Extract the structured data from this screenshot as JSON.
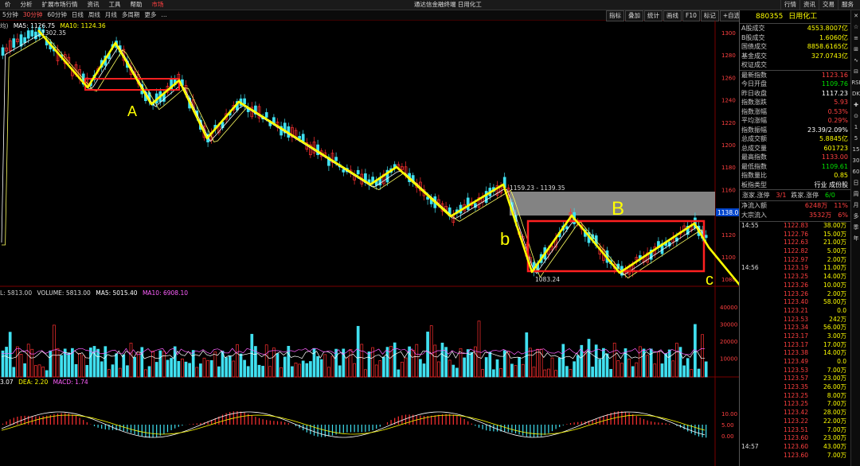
{
  "menu": {
    "items": [
      "价",
      "分析",
      "扩展市场行情",
      "资讯",
      "工具",
      "帮助",
      "市场"
    ],
    "title": "通达信金融终端  日用化工",
    "right": [
      "行情",
      "资讯",
      "交易",
      "服务"
    ]
  },
  "toolbar": {
    "tabs": [
      "5分钟",
      "30分钟",
      "60分钟",
      "日线",
      "周线",
      "月线",
      "多周期",
      "更多",
      "…"
    ],
    "active_index": 1,
    "right_tools": [
      "指标",
      "叠加",
      "统计",
      "画线",
      "F10",
      "标记",
      "+自选",
      "返回"
    ]
  },
  "ma_line": {
    "prefix": "均)",
    "ma5": "MA5: 1126.75",
    "ma10": "MA10: 1124.36"
  },
  "vol_line": {
    "prefix": "L: 5813.00",
    "volume": "VOLUME: 5813.00",
    "ma5": "MA5: 5015.40",
    "ma10": "MA10: 6908.10"
  },
  "macd_line": {
    "dif": "3.07",
    "dea": "DEA: 2.20",
    "macd": "MACD: 1.74"
  },
  "price_axis": [
    "1300",
    "1280",
    "1260",
    "1240",
    "1220",
    "1200",
    "1180",
    "1160",
    "1140",
    "1120",
    "1100",
    "1080"
  ],
  "vol_axis": [
    "40000",
    "30000",
    "20000",
    "10000"
  ],
  "macd_axis": [
    "10.00",
    "5.00",
    "0.00"
  ],
  "annotations": {
    "high_label": "1302.35",
    "mid_label": "1159.23 - 1139.35",
    "low_label": "1083.24",
    "price_tag": "1138.0",
    "letter_a": "A",
    "letter_b": "B",
    "letter_b_small": "b",
    "letter_c": "c"
  },
  "panel": {
    "code": "880355",
    "name": "日用化工",
    "stats": [
      {
        "k": "A股成交",
        "v": "4553.8007亿",
        "c": "#ffff00"
      },
      {
        "k": "B股成交",
        "v": "1.6060亿",
        "c": "#ffff00"
      },
      {
        "k": "国债成交",
        "v": "8858.6165亿",
        "c": "#ffff00"
      },
      {
        "k": "基金成交",
        "v": "327.0743亿",
        "c": "#ffff00"
      },
      {
        "k": "权证成交",
        "v": "",
        "c": "#ffff00"
      }
    ],
    "quote": [
      {
        "k": "最新指数",
        "v": "1123.16",
        "c": "#ff4040"
      },
      {
        "k": "今日开盘",
        "v": "1109.76",
        "c": "#00e000"
      },
      {
        "k": "昨日收盘",
        "v": "1117.23",
        "c": "#ffffff"
      },
      {
        "k": "指数涨跌",
        "v": "5.93",
        "c": "#ff4040"
      },
      {
        "k": "指数涨幅",
        "v": "0.53%",
        "c": "#ff4040"
      },
      {
        "k": "平均涨幅",
        "v": "0.29%",
        "c": "#ff4040"
      },
      {
        "k": "指数振幅",
        "v": "23.39/2.09%",
        "c": "#ffffff"
      },
      {
        "k": "总成交额",
        "v": "5.8845亿",
        "c": "#ffff00"
      },
      {
        "k": "总成交量",
        "v": "601723",
        "c": "#ffff00"
      },
      {
        "k": "最高指数",
        "v": "1133.00",
        "c": "#ff4040"
      },
      {
        "k": "最低指数",
        "v": "1109.61",
        "c": "#00e000"
      },
      {
        "k": "指数量比",
        "v": "0.85",
        "c": "#ffff00"
      },
      {
        "k": "板指类型",
        "v": "行业 成份股",
        "c": "#ffffff"
      }
    ],
    "updown": {
      "up_label": "涨家.涨停",
      "up_val": "3/1",
      "down_label": "跌家.涨停",
      "down_val": "6/0"
    },
    "flows": [
      {
        "k": "净流入额",
        "v": "6248万",
        "p": "11%"
      },
      {
        "k": "大宗流入",
        "v": "3532万",
        "p": "6%"
      }
    ],
    "ticks": [
      {
        "t": "14:55",
        "p": "1122.83",
        "pc": "#ff4040",
        "v": "38.00万"
      },
      {
        "t": "",
        "p": "1122.76",
        "pc": "#ff4040",
        "v": "15.00万"
      },
      {
        "t": "",
        "p": "1122.63",
        "pc": "#ff4040",
        "v": "21.00万"
      },
      {
        "t": "",
        "p": "1122.82",
        "pc": "#ff4040",
        "v": "5.00万"
      },
      {
        "t": "",
        "p": "1122.97",
        "pc": "#ff4040",
        "v": "2.00万"
      },
      {
        "t": "14:56",
        "p": "1123.19",
        "pc": "#ff4040",
        "v": "11.00万"
      },
      {
        "t": "",
        "p": "1123.25",
        "pc": "#ff4040",
        "v": "14.00万"
      },
      {
        "t": "",
        "p": "1123.26",
        "pc": "#ff4040",
        "v": "10.00万"
      },
      {
        "t": "",
        "p": "1123.26",
        "pc": "#ff4040",
        "v": "2.00万"
      },
      {
        "t": "",
        "p": "1123.40",
        "pc": "#ff4040",
        "v": "58.00万"
      },
      {
        "t": "",
        "p": "1123.21",
        "pc": "#ff4040",
        "v": "0.0"
      },
      {
        "t": "",
        "p": "1123.53",
        "pc": "#ff4040",
        "v": "242万"
      },
      {
        "t": "",
        "p": "1123.34",
        "pc": "#ff4040",
        "v": "56.00万"
      },
      {
        "t": "",
        "p": "1123.17",
        "pc": "#ff4040",
        "v": "3.00万"
      },
      {
        "t": "",
        "p": "1123.17",
        "pc": "#ff4040",
        "v": "17.00万"
      },
      {
        "t": "",
        "p": "1123.38",
        "pc": "#ff4040",
        "v": "14.00万"
      },
      {
        "t": "",
        "p": "1123.49",
        "pc": "#ff4040",
        "v": "0.0"
      },
      {
        "t": "",
        "p": "1123.53",
        "pc": "#ff4040",
        "v": "7.00万"
      },
      {
        "t": "",
        "p": "1123.57",
        "pc": "#ff4040",
        "v": "23.00万"
      },
      {
        "t": "",
        "p": "1123.35",
        "pc": "#ff4040",
        "v": "26.00万"
      },
      {
        "t": "",
        "p": "1123.25",
        "pc": "#ff4040",
        "v": "8.00万"
      },
      {
        "t": "",
        "p": "1123.25",
        "pc": "#ff4040",
        "v": "7.00万"
      },
      {
        "t": "",
        "p": "1123.42",
        "pc": "#ff4040",
        "v": "28.00万"
      },
      {
        "t": "",
        "p": "1123.22",
        "pc": "#ff4040",
        "v": "22.00万"
      },
      {
        "t": "",
        "p": "1123.51",
        "pc": "#ff4040",
        "v": "7.00万"
      },
      {
        "t": "",
        "p": "1123.60",
        "pc": "#ff4040",
        "v": "23.00万"
      },
      {
        "t": "14:57",
        "p": "1123.60",
        "pc": "#ff4040",
        "v": "43.00万"
      },
      {
        "t": "",
        "p": "1123.60",
        "pc": "#ff4040",
        "v": "7.00万"
      }
    ]
  },
  "rightbar": [
    "✕",
    "☆",
    "≡",
    "⊞",
    "∿",
    "⊟",
    "RSI",
    "DK",
    "✚",
    "⊙",
    "1",
    "5",
    "15",
    "30",
    "60",
    "日",
    "周",
    "月",
    "多",
    "季",
    "年"
  ],
  "colors": {
    "up": "#ff3030",
    "down": "#40e0f0",
    "zigzag": "#ffff00",
    "box": "#ff2020",
    "ma10": "#ff60ff"
  }
}
